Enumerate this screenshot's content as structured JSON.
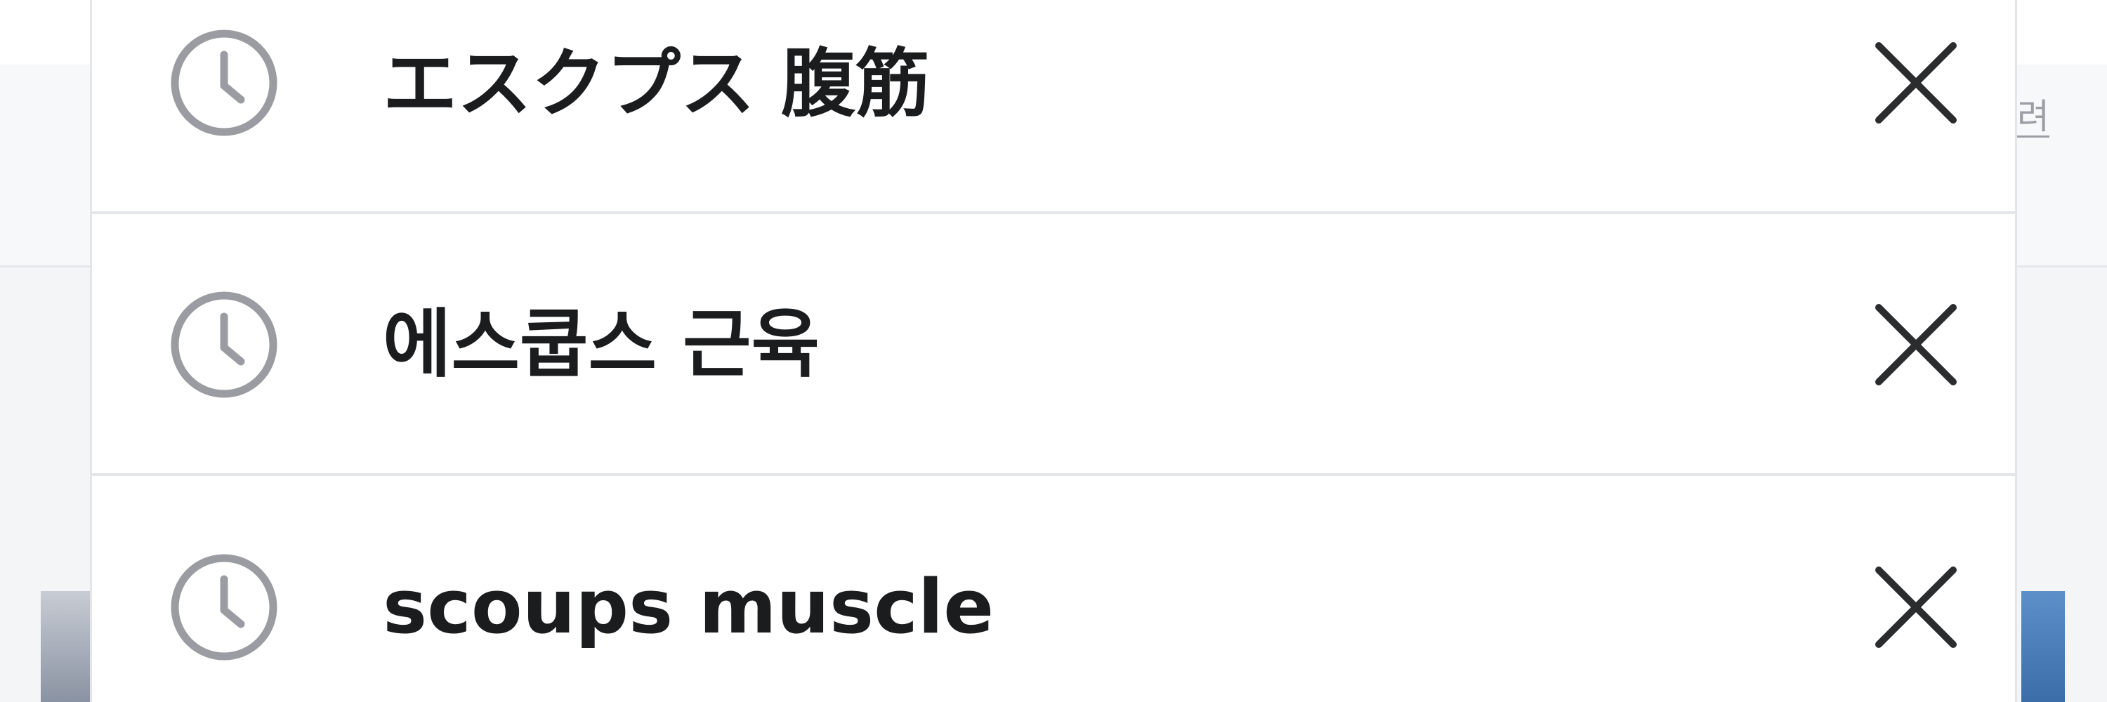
{
  "background": {
    "link_text": "려"
  },
  "recent_searches": [
    {
      "label": "エスクプス 腹筋",
      "icon": "clock-icon",
      "remove_icon": "close-icon"
    },
    {
      "label": "에스쿱스 근육",
      "icon": "clock-icon",
      "remove_icon": "close-icon"
    },
    {
      "label": "scoups muscle",
      "icon": "clock-icon",
      "remove_icon": "close-icon"
    }
  ],
  "colors": {
    "text": "#1b1c1e",
    "icon": "#9a9ca1",
    "divider": "#e4e6e9"
  }
}
